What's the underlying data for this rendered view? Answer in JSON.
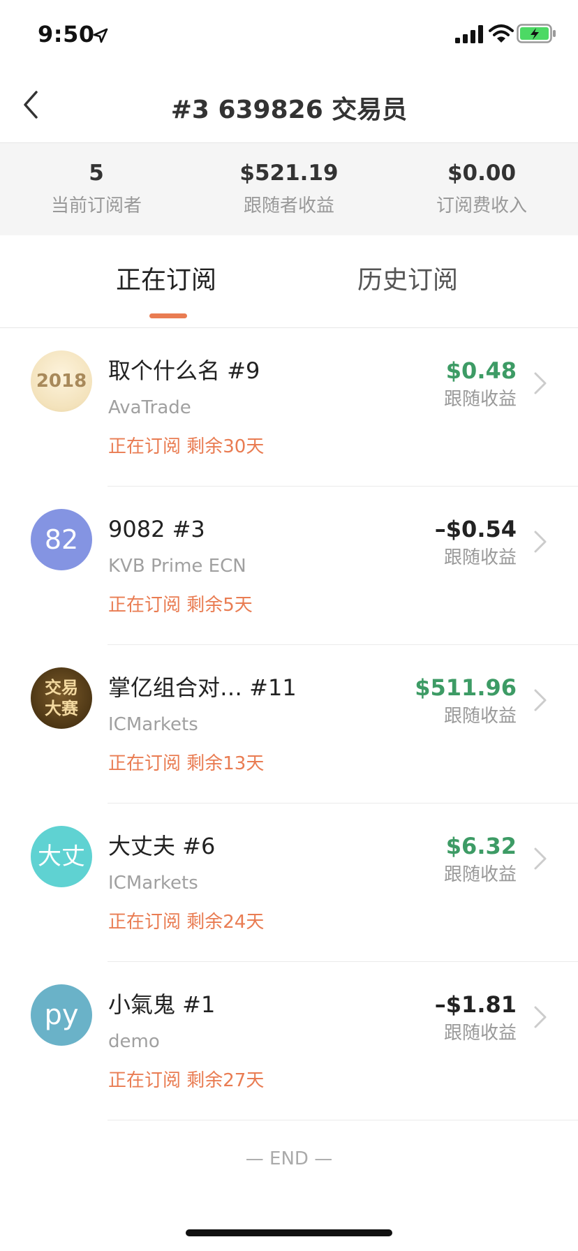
{
  "status_bar": {
    "time": "9:50"
  },
  "nav": {
    "title": "#3 639826 交易员"
  },
  "stats": [
    {
      "value": "5",
      "label": "当前订阅者"
    },
    {
      "value": "$521.19",
      "label": "跟随者收益"
    },
    {
      "value": "$0.00",
      "label": "订阅费收入"
    }
  ],
  "tabs": [
    {
      "label": "正在订阅"
    },
    {
      "label": "历史订阅"
    }
  ],
  "subscriptions": [
    {
      "avatar_text": "2018",
      "name": "取个什么名 #9",
      "broker": "AvaTrade",
      "status": "正在订阅 剩余30天",
      "amount": "$0.48",
      "amount_label": "跟随收益"
    },
    {
      "avatar_text": "82",
      "name": "9082 #3",
      "broker": "KVB Prime ECN",
      "status": "正在订阅 剩余5天",
      "amount": "–$0.54",
      "amount_label": "跟随收益"
    },
    {
      "avatar_text": "交易大赛",
      "name": "掌亿组合对… #11",
      "broker": "ICMarkets",
      "status": "正在订阅 剩余13天",
      "amount": "$511.96",
      "amount_label": "跟随收益"
    },
    {
      "avatar_text": "大丈",
      "name": "大丈夫 #6",
      "broker": "ICMarkets",
      "status": "正在订阅 剩余24天",
      "amount": "$6.32",
      "amount_label": "跟随收益"
    },
    {
      "avatar_text": "py",
      "name": "小氣鬼 #1",
      "broker": "demo",
      "status": "正在订阅 剩余27天",
      "amount": "–$1.81",
      "amount_label": "跟随收益"
    }
  ],
  "footer": {
    "end_text": "— END —"
  },
  "colors": {
    "accent": "#e97c52",
    "positive": "#3d9b65",
    "negative": "#222222"
  },
  "icons": [
    "location-arrow-icon",
    "signal-icon",
    "wifi-icon",
    "battery-charging-icon",
    "back-chevron-icon",
    "chevron-right-icon"
  ]
}
